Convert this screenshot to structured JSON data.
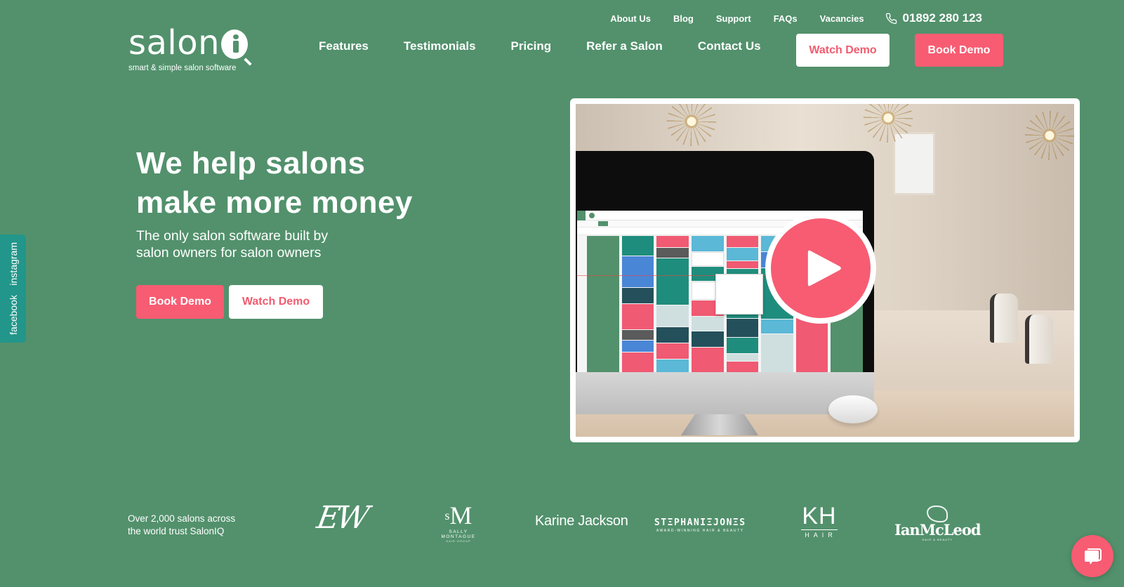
{
  "brand": {
    "name": "salon",
    "tagline": "smart & simple salon software",
    "colors": {
      "background": "#52916c",
      "accent": "#f75c72",
      "social_tab": "#22968a",
      "text": "#ffffff"
    }
  },
  "top_links": [
    {
      "label": "About Us"
    },
    {
      "label": "Blog"
    },
    {
      "label": "Support"
    },
    {
      "label": "FAQs"
    },
    {
      "label": "Vacancies"
    }
  ],
  "phone": {
    "icon": "phone-icon",
    "number": "01892 280 123"
  },
  "main_nav": [
    {
      "label": "Features"
    },
    {
      "label": "Testimonials"
    },
    {
      "label": "Pricing"
    },
    {
      "label": "Refer a Salon"
    },
    {
      "label": "Contact Us"
    }
  ],
  "header_buttons": {
    "watch_demo": "Watch Demo",
    "book_demo": "Book Demo"
  },
  "social": [
    {
      "label": "instagram"
    },
    {
      "label": "facebook"
    }
  ],
  "hero": {
    "title_lines": [
      "We help salons",
      "make more money"
    ],
    "subtitle_lines": [
      "The only salon software built by",
      "salon owners for salon owners"
    ],
    "book_demo": "Book Demo",
    "watch_demo": "Watch Demo"
  },
  "video": {
    "play_icon": "play-icon",
    "description": "Salon software on desktop monitor in salon interior"
  },
  "trust": {
    "lines": [
      "Over 2,000 salons across",
      "the world trust SalonIQ"
    ],
    "client_logos": [
      {
        "name": "EW",
        "text": "EW"
      },
      {
        "name": "Sally Montague",
        "mark": "sM",
        "subtitle": "SALLY MONTAGUE",
        "subtitle2": "HAIR GROUP"
      },
      {
        "name": "Karine Jackson",
        "text": "Karine Jackson"
      },
      {
        "name": "Stephanie Jones",
        "text": "STΞPHANIΞJONΞS",
        "subtitle": "AWARD-WINNING HAIR & BEAUTY"
      },
      {
        "name": "KH Hair",
        "text": "KH",
        "subtitle": "HAIR"
      },
      {
        "name": "Ian McLeod",
        "text": "IanMcLeod",
        "subtitle": "HAIR & BEAUTY"
      }
    ]
  },
  "chat": {
    "icon": "chat-bubble-icon"
  }
}
